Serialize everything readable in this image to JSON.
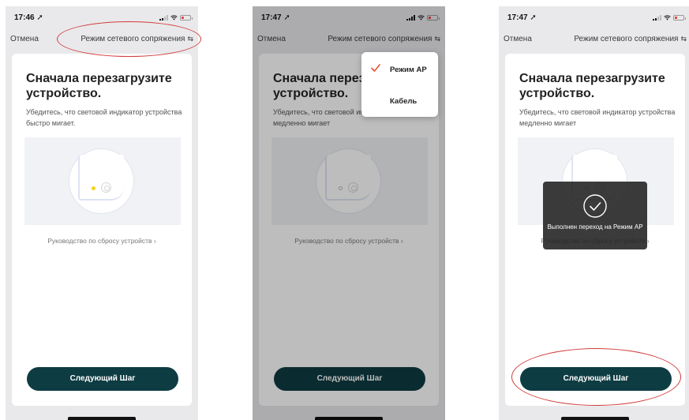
{
  "phones": [
    {
      "status_time": "17:46 ➚",
      "nav": {
        "cancel": "Отмена",
        "mode": "Режим сетевого сопряжения",
        "mode_icon": "⇆"
      },
      "card": {
        "title": "Сначала перезагрузите устройство.",
        "desc": "Убедитесь, что световой индикатор устройства быстро мигает.",
        "guide": "Руководство по сбросу устройств ›",
        "next": "Следующий Шаг"
      }
    },
    {
      "status_time": "17:47 ➚",
      "nav": {
        "cancel": "Отмена",
        "mode": "Режим сетевого сопряжения",
        "mode_icon": "⇆"
      },
      "card": {
        "title": "Сначала перезагрузите устройство.",
        "desc": "Убедитесь, что световой индикатор устройства медленно мигает",
        "guide": "Руководство по сбросу устройств ›",
        "next": "Следующий Шаг"
      },
      "dropdown": {
        "items": [
          {
            "label": "Режим AP",
            "selected": true
          },
          {
            "label": "Кабель",
            "selected": false
          }
        ]
      }
    },
    {
      "status_time": "17:47 ➚",
      "nav": {
        "cancel": "Отмена",
        "mode": "Режим сетевого сопряжения",
        "mode_icon": "⇆"
      },
      "card": {
        "title": "Сначала перезагрузите устройство.",
        "desc": "Убедитесь, что световой индикатор устройства медленно мигает",
        "guide": "Руководство по сбросу устройств ›",
        "next": "Следующий Шаг"
      },
      "toast": {
        "text": "Выполнен переход на Режим AP"
      }
    }
  ],
  "colors": {
    "accent": "#0e3c43",
    "check": "#e8532f",
    "annotation": "#d23b3b"
  },
  "icons": [
    "location-arrow-icon",
    "signal-icon",
    "wifi-icon",
    "battery-icon",
    "switch-arrows-icon",
    "checkmark-icon",
    "power-icon",
    "chevron-right-icon"
  ]
}
